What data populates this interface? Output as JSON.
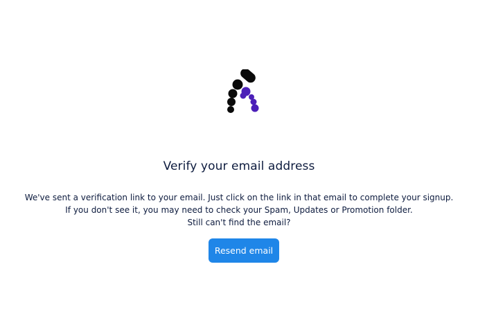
{
  "logo": {
    "name": "brand-logo",
    "colors": {
      "dark": "#0a0a0a",
      "accent": "#4b1fb8"
    }
  },
  "verify": {
    "title": "Verify your email address",
    "lines": [
      "We've sent a verification link to your email. Just click on the link in that email to complete your signup.",
      "If you don't see it, you may need to check your Spam, Updates or Promotion folder.",
      "Still can't find the email?"
    ],
    "resend_label": "Resend email"
  },
  "colors": {
    "text": "#0d1b3e",
    "button": "#1f86e8"
  }
}
